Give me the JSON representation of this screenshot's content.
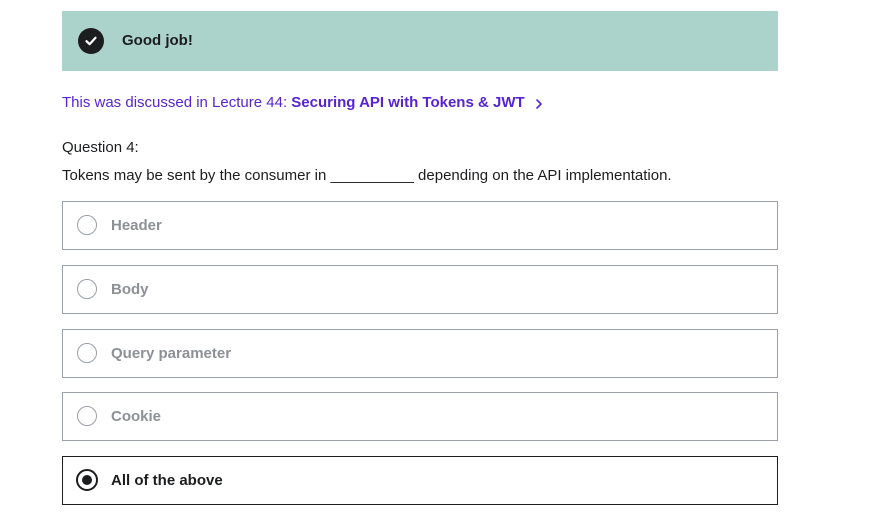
{
  "banner": {
    "message": "Good job!",
    "icon": "check-circle-icon",
    "color": "#acd2cc"
  },
  "lecture": {
    "prefix": "This was discussed in Lecture 44: ",
    "title": "Securing API with Tokens & JWT",
    "link_color": "#5624d0"
  },
  "question": {
    "label": "Question 4:",
    "text": "Tokens may be sent by the consumer in __________ depending on the API implementation."
  },
  "options": [
    {
      "label": "Header",
      "selected": false
    },
    {
      "label": "Body",
      "selected": false
    },
    {
      "label": "Query parameter",
      "selected": false
    },
    {
      "label": "Cookie",
      "selected": false
    },
    {
      "label": "All of the above",
      "selected": true
    }
  ]
}
